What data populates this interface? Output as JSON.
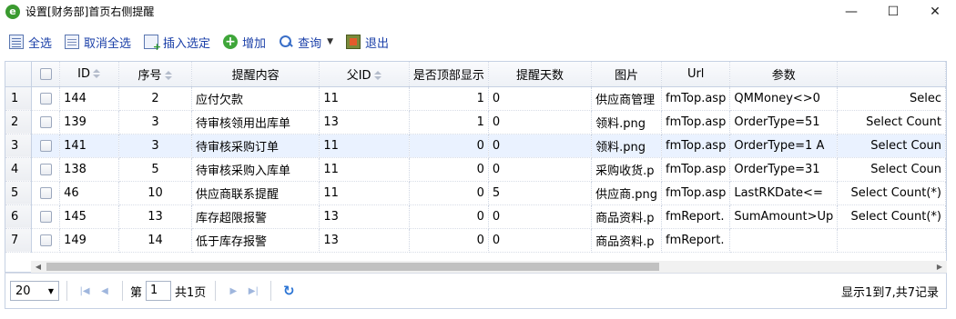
{
  "window": {
    "title": "设置[财务部]首页右侧提醒",
    "icon": "ie-icon",
    "minimize": "—",
    "maximize": "☐",
    "close": "✕"
  },
  "toolbar": {
    "select_all": "全选",
    "cancel_select_all": "取消全选",
    "insert_selected": "插入选定",
    "add": "增加",
    "query": "查询",
    "exit": "退出"
  },
  "grid": {
    "headers": {
      "id": "ID",
      "seq": "序号",
      "content": "提醒内容",
      "parent_id": "父ID",
      "show_top": "是否顶部显示",
      "days": "提醒天数",
      "image": "图片",
      "url": "Url",
      "params": "参数",
      "sql": ""
    },
    "rows": [
      {
        "rn": "1",
        "id": "144",
        "seq": "2",
        "content": "应付欠款",
        "parent_id": "11",
        "show_top": "1",
        "days": "0",
        "image": "供应商管理",
        "url": "fmTop.asp",
        "params": "QMMoney<>0",
        "sql": "Selec"
      },
      {
        "rn": "2",
        "id": "139",
        "seq": "3",
        "content": "待审核领用出库单",
        "parent_id": "13",
        "show_top": "1",
        "days": "0",
        "image": "领料.png",
        "url": "fmTop.asp",
        "params": "OrderType=51",
        "sql": "Select Count"
      },
      {
        "rn": "3",
        "id": "141",
        "seq": "3",
        "content": "待审核采购订单",
        "parent_id": "11",
        "show_top": "0",
        "days": "0",
        "image": "领料.png",
        "url": "fmTop.asp",
        "params": "OrderType=1 A",
        "sql": "Select Coun"
      },
      {
        "rn": "4",
        "id": "138",
        "seq": "5",
        "content": "待审核采购入库单",
        "parent_id": "11",
        "show_top": "0",
        "days": "0",
        "image": "采购收货.p",
        "url": "fmTop.asp",
        "params": "OrderType=31",
        "sql": "Select Coun"
      },
      {
        "rn": "5",
        "id": "46",
        "seq": "10",
        "content": "供应商联系提醒",
        "parent_id": "11",
        "show_top": "0",
        "days": "5",
        "image": "供应商.png",
        "url": "fmTop.asp",
        "params": "LastRKDate<=",
        "sql": "Select Count(*)"
      },
      {
        "rn": "6",
        "id": "145",
        "seq": "13",
        "content": "库存超限报警",
        "parent_id": "13",
        "show_top": "0",
        "days": "0",
        "image": "商品资料.p",
        "url": "fmReport.",
        "params": "SumAmount>Up",
        "sql": "Select Count(*)"
      },
      {
        "rn": "7",
        "id": "149",
        "seq": "14",
        "content": "低于库存报警",
        "parent_id": "13",
        "show_top": "0",
        "days": "0",
        "image": "商品资料.p",
        "url": "fmReport.",
        "params": "",
        "sql": ""
      }
    ],
    "highlighted_row": 3
  },
  "pager": {
    "page_size": "20",
    "page_prefix": "第",
    "page_number": "1",
    "page_total": "共1页",
    "info": "显示1到7,共7记录"
  }
}
